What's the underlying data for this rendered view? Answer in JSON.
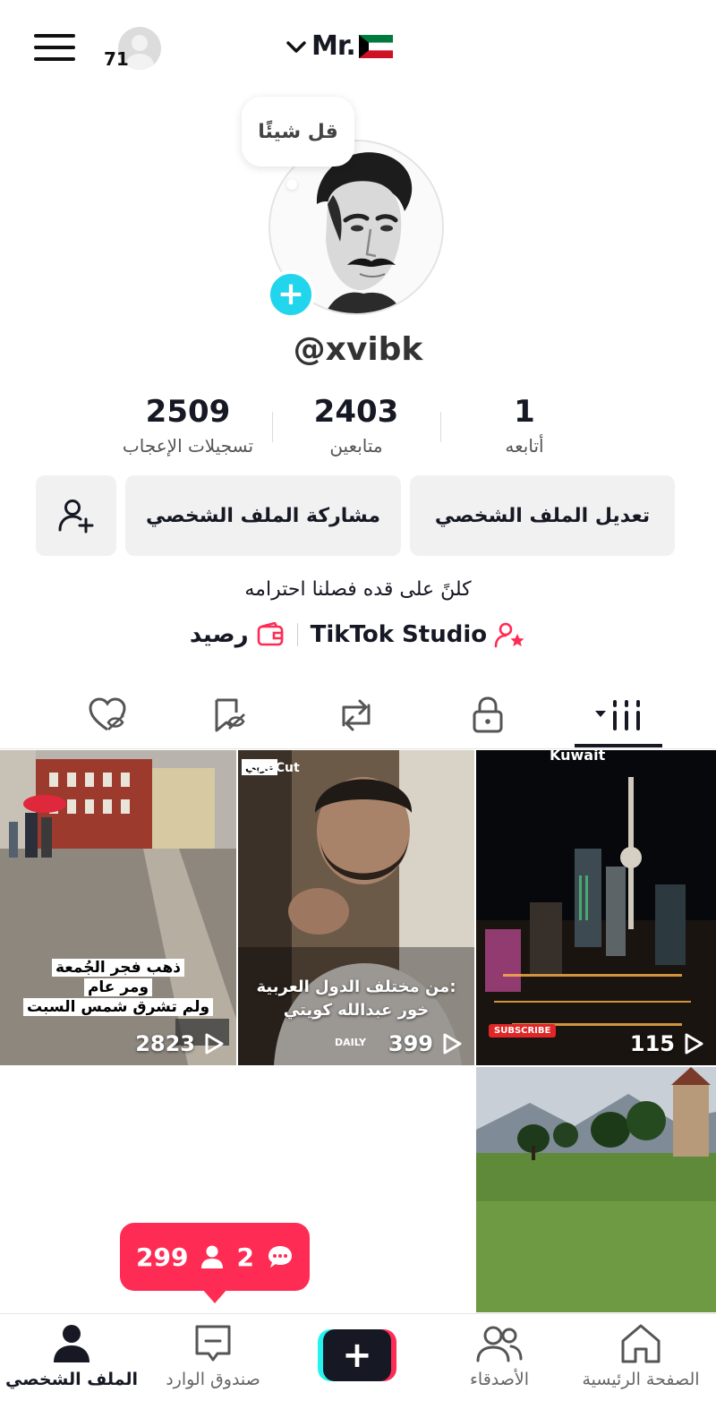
{
  "header": {
    "notification_count": "71",
    "account_name": "Mr.",
    "menu_icon": "hamburger-menu-icon"
  },
  "profile": {
    "note_bubble": "قل شيئًا",
    "username": "@xvibk",
    "bio": "كلنً على قده فصلنا احترامه"
  },
  "stats": {
    "likes": {
      "value": "2509",
      "label": "تسجيلات الإعجاب"
    },
    "followers": {
      "value": "2403",
      "label": "متابعين"
    },
    "following": {
      "value": "1",
      "label": "أتابعه"
    }
  },
  "buttons": {
    "edit_profile": "تعديل الملف الشخصي",
    "share_profile": "مشاركة الملف الشخصي"
  },
  "links": {
    "studio": "TikTok Studio",
    "balance": "رصيد"
  },
  "videos": [
    {
      "views": "2823",
      "caption_lines": [
        "ذهب فجر الجُمعة",
        "ومر عام",
        "ولم تشرق شمس السبت"
      ]
    },
    {
      "views": "399",
      "caption_lines": [
        "من مختلف الدول العربية:",
        "خور عبدالله كويتي"
      ],
      "badge": "CapCut",
      "corner": "عربي",
      "footer_tag": "DAILY"
    },
    {
      "views": "115",
      "top_label": "Kuwait",
      "subscribe": "SUBSCRIBE"
    },
    {
      "views": ""
    }
  ],
  "toast": {
    "followers_count": "299",
    "comments_count": "2"
  },
  "bottom_nav": {
    "home": "الصفحة الرئيسية",
    "friends": "الأصدقاء",
    "inbox": "صندوق الوارد",
    "profile": "الملف الشخصي"
  },
  "colors": {
    "accent": "#fe2c55",
    "cyan": "#25f4ee",
    "text": "#161823"
  }
}
